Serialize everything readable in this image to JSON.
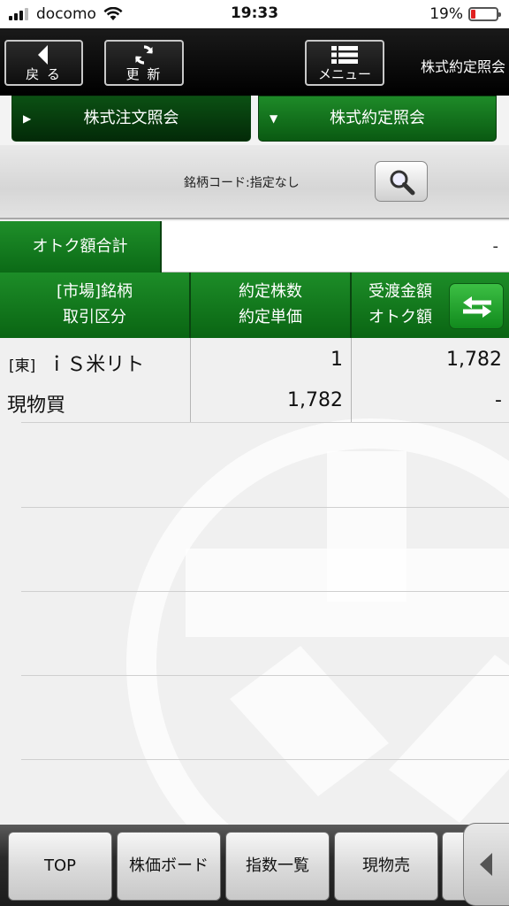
{
  "status": {
    "carrier": "docomo",
    "time": "19:33",
    "battery": "19%",
    "battery_level": 0.19,
    "battery_color": "#e02020"
  },
  "nav": {
    "back_label": "戻 る",
    "refresh_label": "更 新",
    "menu_label": "メニュー",
    "title": "株式約定照会"
  },
  "tabs": [
    {
      "label": "株式注文照会",
      "indicator": "right-triangle"
    },
    {
      "label": "株式約定照会",
      "indicator": "down-triangle"
    }
  ],
  "search": {
    "label": "銘柄コード:指定なし",
    "icon": "magnifier-icon"
  },
  "total": {
    "label": "オトク額合計",
    "value": "-"
  },
  "table": {
    "headers": [
      {
        "line1": "[市場]銘柄",
        "line2": "取引区分"
      },
      {
        "line1": "約定株数",
        "line2": "約定単価"
      },
      {
        "line1": "受渡金額",
        "line2": "オトク額"
      }
    ],
    "rows": [
      {
        "market": "[東]",
        "name": "ｉＳ米リト",
        "trade_type": "現物買",
        "shares": "1",
        "unit_price": "1,782",
        "amount": "1,782",
        "otoku": "-"
      }
    ]
  },
  "bottom_bar": {
    "buttons": [
      "TOP",
      "株価ボード",
      "指数一覧",
      "現物売"
    ]
  },
  "colors": {
    "accent_green": "#1d8d28",
    "dark_green": "#0a5a12",
    "nav_black": "#0a0a0a"
  }
}
